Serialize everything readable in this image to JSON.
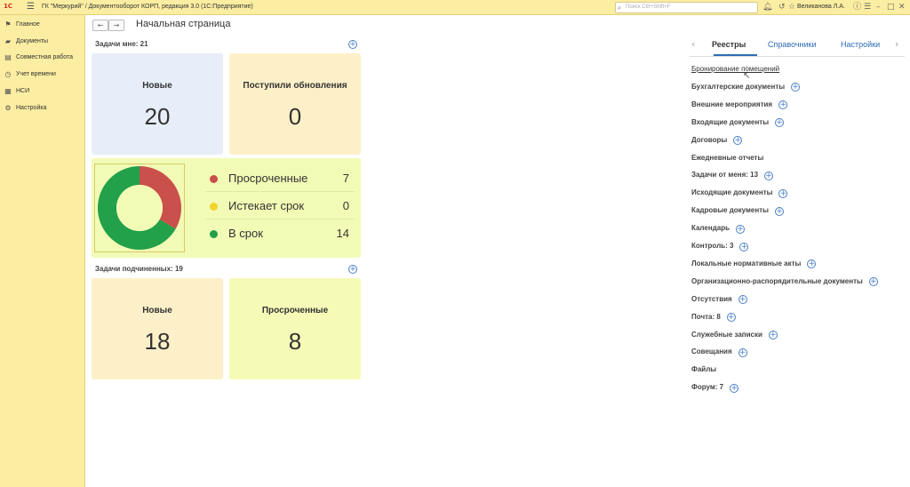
{
  "titlebar": {
    "logo": "1С",
    "title": "ГК \"Меркурий\" / Документооборот КОРП, редакция 3.0  (1С:Предприятие)",
    "search_placeholder": "Поиск Ctrl+Shift+F",
    "user": "Великанова Л.А.",
    "icons": [
      "bell-icon",
      "history-icon",
      "star-icon",
      "info-icon",
      "menu-icon",
      "minimize-icon",
      "maximize-icon",
      "close-icon"
    ]
  },
  "sidebar": {
    "items": [
      {
        "label": "Главное",
        "icon": "flag-icon"
      },
      {
        "label": "Документы",
        "icon": "folder-icon"
      },
      {
        "label": "Совместная работа",
        "icon": "book-icon"
      },
      {
        "label": "Учет времени",
        "icon": "clock-icon"
      },
      {
        "label": "НСИ",
        "icon": "table-icon"
      },
      {
        "label": "Настройка",
        "icon": "settings-icon"
      }
    ]
  },
  "main": {
    "title": "Начальная страница",
    "my_tasks_label": "Задачи мне: 21",
    "tiles_top": [
      {
        "label": "Новые",
        "value": "20",
        "color": "#e7eefa"
      },
      {
        "label": "Поступили обновления",
        "value": "0",
        "color": "#fdf0c8"
      }
    ],
    "legend": [
      {
        "name": "Просроченные",
        "value": "7",
        "color": "#c9504b"
      },
      {
        "name": "Истекает срок",
        "value": "0",
        "color": "#f1d32c"
      },
      {
        "name": "В срок",
        "value": "14",
        "color": "#23a04a"
      }
    ],
    "sub_tasks_label": "Задачи подчиненных: 19",
    "tiles_bottom": [
      {
        "label": "Новые",
        "value": "18",
        "color": "#fdf0c8"
      },
      {
        "label": "Просроченные",
        "value": "8",
        "color": "#f5fbb7"
      }
    ]
  },
  "chart_data": {
    "type": "pie",
    "categories": [
      "Просроченные",
      "Истекает срок",
      "В срок"
    ],
    "values": [
      7,
      0,
      14
    ],
    "colors": [
      "#c9504b",
      "#f1d32c",
      "#23a04a"
    ]
  },
  "right_panel": {
    "tabs": [
      "Реестры",
      "Справочники",
      "Настройки"
    ],
    "active_tab": "Реестры",
    "registers": [
      {
        "label": "Бронирование помещений",
        "plus": false
      },
      {
        "label": "Бухгалтерские документы",
        "plus": true
      },
      {
        "label": "Внешние мероприятия",
        "plus": true
      },
      {
        "label": "Входящие документы",
        "plus": true
      },
      {
        "label": "Договоры",
        "plus": true
      },
      {
        "label": "Ежедневные отчеты",
        "plus": false
      },
      {
        "label": "Задачи от меня: 13",
        "plus": true
      },
      {
        "label": "Исходящие документы",
        "plus": true
      },
      {
        "label": "Кадровые документы",
        "plus": true
      },
      {
        "label": "Календарь",
        "plus": true
      },
      {
        "label": "Контроль: 3",
        "plus": true
      },
      {
        "label": "Локальные нормативные акты",
        "plus": true
      },
      {
        "label": "Организационно-распорядительные документы",
        "plus": true
      },
      {
        "label": "Отсутствия",
        "plus": true
      },
      {
        "label": "Почта: 8",
        "plus": true
      },
      {
        "label": "Служебные записки",
        "plus": true
      },
      {
        "label": "Совещания",
        "plus": true
      },
      {
        "label": "Файлы",
        "plus": false
      },
      {
        "label": "Форум: 7",
        "plus": true
      }
    ]
  }
}
